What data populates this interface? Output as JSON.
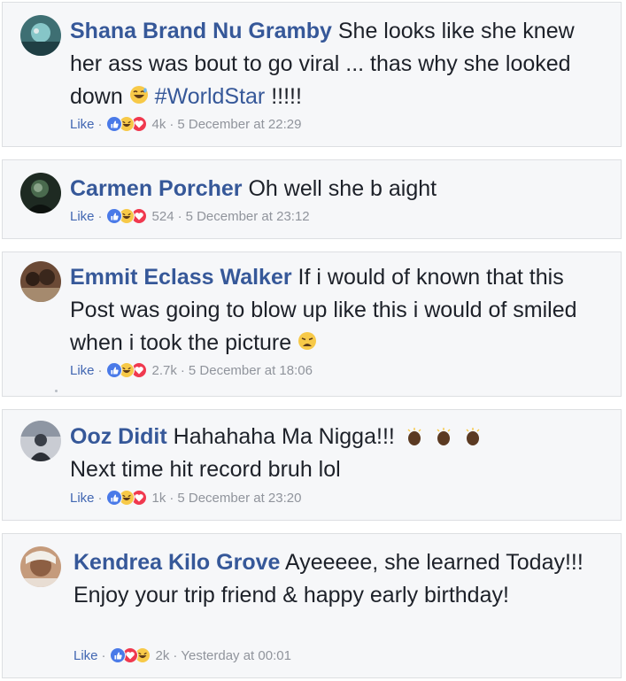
{
  "comments": [
    {
      "author": "Shana Brand Nu Gramby",
      "text_before": "She looks like she knew her ass was bout to go viral ... thas why she looked down",
      "emoji": "grinning-sweat-emoji",
      "hashtag": "#WorldStar",
      "text_after": " !!!!!",
      "like_label": "Like",
      "reaction_icons": [
        "like",
        "haha",
        "love"
      ],
      "reaction_count": "4k",
      "timestamp": "5 December at 22:29"
    },
    {
      "author": "Carmen Porcher",
      "text_before": "Oh well she b aight",
      "like_label": "Like",
      "reaction_icons": [
        "like",
        "haha",
        "love"
      ],
      "reaction_count": "524",
      "timestamp": "5 December at 23:12"
    },
    {
      "author": "Emmit Eclass Walker",
      "text_before": "If i would of known that this Post was going to blow up like this i would of smiled when i took the picture",
      "emoji": "tired-face-emoji",
      "like_label": "Like",
      "reaction_icons": [
        "like",
        "haha",
        "love"
      ],
      "reaction_count": "2.7k",
      "timestamp": "5 December at 18:06"
    },
    {
      "author": "Ooz Didit",
      "text_before": "Hahahaha Ma Nigga!!!",
      "emoji": "clapping-hands-emoji",
      "text_after": "Next time hit record bruh lol",
      "like_label": "Like",
      "reaction_icons": [
        "like",
        "haha",
        "love"
      ],
      "reaction_count": "1k",
      "timestamp": "5 December at 23:20"
    },
    {
      "author": "Kendrea Kilo Grove",
      "text_before": "Ayeeeee, she learned Today!!! Enjoy your trip friend & happy early birthday!",
      "like_label": "Like",
      "reaction_icons": [
        "like",
        "love",
        "haha"
      ],
      "reaction_count": "2k",
      "timestamp": "Yesterday at 00:01"
    }
  ],
  "colors": {
    "author": "#365899",
    "text": "#1d2129",
    "meta": "#90949c",
    "card_bg": "#f6f7f9",
    "card_border": "#dddfe2",
    "like_reaction": "#4a7ae8",
    "haha_reaction": "#f7c948",
    "love_reaction": "#f0394f"
  }
}
